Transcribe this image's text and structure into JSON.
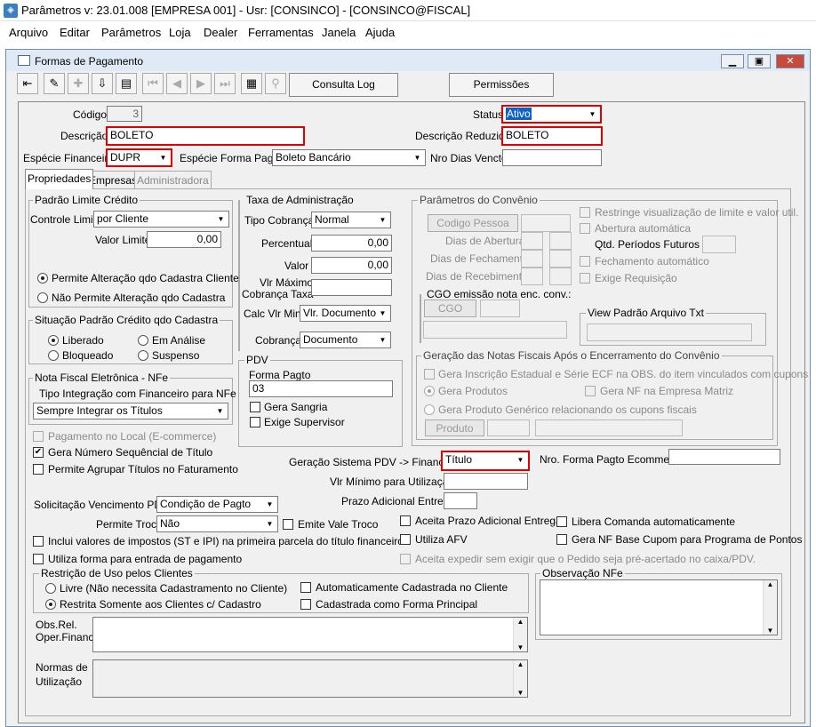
{
  "window": {
    "icon": "app-icon",
    "title": "Parâmetros  v: 23.01.008  [EMPRESA 001] - Usr: [CONSINCO] - [CONSINCO@FISCAL]"
  },
  "menu": [
    "Arquivo",
    "Editar",
    "Parâmetros",
    "Loja",
    "Dealer",
    "Ferramentas",
    "Janela",
    "Ajuda"
  ],
  "form": {
    "title": "Formas de Pagamento",
    "toolbar": {
      "consulta_log": "Consulta Log",
      "permissoes": "Permissões"
    },
    "codigo": {
      "label": "Código",
      "value": "3"
    },
    "status": {
      "label": "Status",
      "value": "Ativo"
    },
    "descricao": {
      "label": "Descrição",
      "value": "BOLETO"
    },
    "descricao_reduzida": {
      "label": "Descrição Reduzida",
      "value": "BOLETO"
    },
    "especie_financeira": {
      "label": "Espécie Financeira",
      "value": "DUPR"
    },
    "especie_forma_pagto": {
      "label": "Espécie Forma Pagto",
      "value": "Boleto Bancário"
    },
    "nro_dias_vencto": {
      "label": "Nro Dias Vencto",
      "value": ""
    },
    "tabs": [
      "Propriedades",
      "Empresas",
      "Administradora"
    ]
  },
  "props": {
    "padrao_limite": {
      "title": "Padrão Limite Crédito",
      "controle_label": "Controle Limite",
      "controle_value": "por Cliente",
      "valor_label": "Valor Limite",
      "valor_value": "0,00",
      "radio1": "Permite Alteração qdo Cadastra Cliente",
      "radio2": "Não Permite Alteração qdo Cadastra"
    },
    "situacao": {
      "title": "Situação Padrão Crédito qdo Cadastra",
      "liberado": "Liberado",
      "em_analise": "Em Análise",
      "bloqueado": "Bloqueado",
      "suspenso": "Suspenso"
    },
    "nfe": {
      "title": "Nota Fiscal Eletrônica - NFe",
      "tipo_label": "Tipo Integração com Financeiro para NFe",
      "tipo_value": "Sempre Integrar os Títulos"
    },
    "taxa": {
      "title": "Taxa de Administração",
      "tipo_label": "Tipo Cobrança",
      "tipo_value": "Normal",
      "percentual_label": "Percentual",
      "percentual_value": "0,00",
      "valor_label": "Valor",
      "valor_value": "0,00",
      "vlr_max_label1": "Vlr Máximo",
      "vlr_max_label2": "Cobrança Taxa",
      "calc_label": "Calc Vlr Min",
      "calc_value": "Vlr. Documento",
      "cobranca_label": "Cobrança",
      "cobranca_value": "Documento"
    },
    "pdv": {
      "title": "PDV",
      "forma_label": "Forma Pagto",
      "forma_value": "03",
      "gera_sangria": "Gera Sangria",
      "exige_supervisor": "Exige Supervisor"
    },
    "convenio": {
      "title": "Parâmetros do Convênio",
      "codigo_pessoa": "Codigo Pessoa",
      "dias_abertura": "Dias de Abertura",
      "dias_fechamento": "Dias de Fechamento",
      "dias_recebimento": "Dias de Recebimento",
      "restringe": "Restringe visualização de limite e valor util.",
      "abertura_auto": "Abertura automática",
      "qtd_periodos": "Qtd. Períodos Futuros",
      "fechamento_auto": "Fechamento automático",
      "exige_requisicao": "Exige Requisição",
      "cgo_title": "CGO emissão nota enc. conv.:",
      "cgo_button": "CGO",
      "view_title": "View Padrão Arquivo Txt"
    },
    "geracao_notas": {
      "title": "Geração das Notas Fiscais Após o Encerramento do Convênio",
      "opt1": "Gera Inscrição Estadual e Série ECF na OBS. do item vinculados com cupons",
      "opt2": "Gera Produtos",
      "opt3": "Gera NF na Empresa Matriz",
      "opt4": "Gera Produto Genérico relacionando os cupons fiscais",
      "produto_button": "Produto"
    },
    "pagamento_local": "Pagamento no Local (E-commerce)",
    "gera_numero_seq": "Gera Número Sequêncial de Título",
    "permite_agrupar": "Permite Agrupar Títulos no Faturamento",
    "geracao_sistema": {
      "label": "Geração Sistema PDV -> Financeiro",
      "value": "Título"
    },
    "nro_forma_ecommerce": {
      "label": "Nro. Forma Pagto Ecommerce",
      "value": ""
    },
    "vlr_minimo": {
      "label": "Vlr Mínimo para Utilização",
      "value": ""
    },
    "prazo_adicional": {
      "label": "Prazo Adicional Entrega",
      "value": ""
    },
    "solicitacao": {
      "label": "Solicitação Vencimento PDV",
      "value": "Condição de Pagto"
    },
    "permite_troco": {
      "label": "Permite Troco",
      "value": "Não"
    },
    "emite_vale_troco": "Emite Vale Troco",
    "aceita_prazo": "Aceita Prazo Adicional Entrega",
    "libera_comanda": "Libera Comanda automaticamente",
    "inclui_impostos": "Inclui valores de impostos (ST e IPI) na primeira parcela do título financeiro",
    "utiliza_afv": "Utiliza AFV",
    "gera_nf_base": "Gera NF Base Cupom para Programa de Pontos",
    "utiliza_forma_entrada": "Utiliza forma para entrada de pagamento",
    "aceita_expedir": "Aceita expedir sem exigir que o Pedido seja pré-acertado no caixa/PDV.",
    "restricao": {
      "title": "Restrição de Uso pelos Clientes",
      "livre": "Livre (Não necessita Cadastramento no Cliente)",
      "restrita": "Restrita Somente aos Clientes c/ Cadastro",
      "automatica": "Automaticamente Cadastrada no Cliente",
      "principal": "Cadastrada como Forma Principal"
    },
    "observacao_title": "Observação NFe",
    "obs_rel_1": "Obs.Rel.",
    "obs_rel_2": "Oper.Financ.",
    "normas_1": "Normas de",
    "normas_2": "Utilização"
  }
}
